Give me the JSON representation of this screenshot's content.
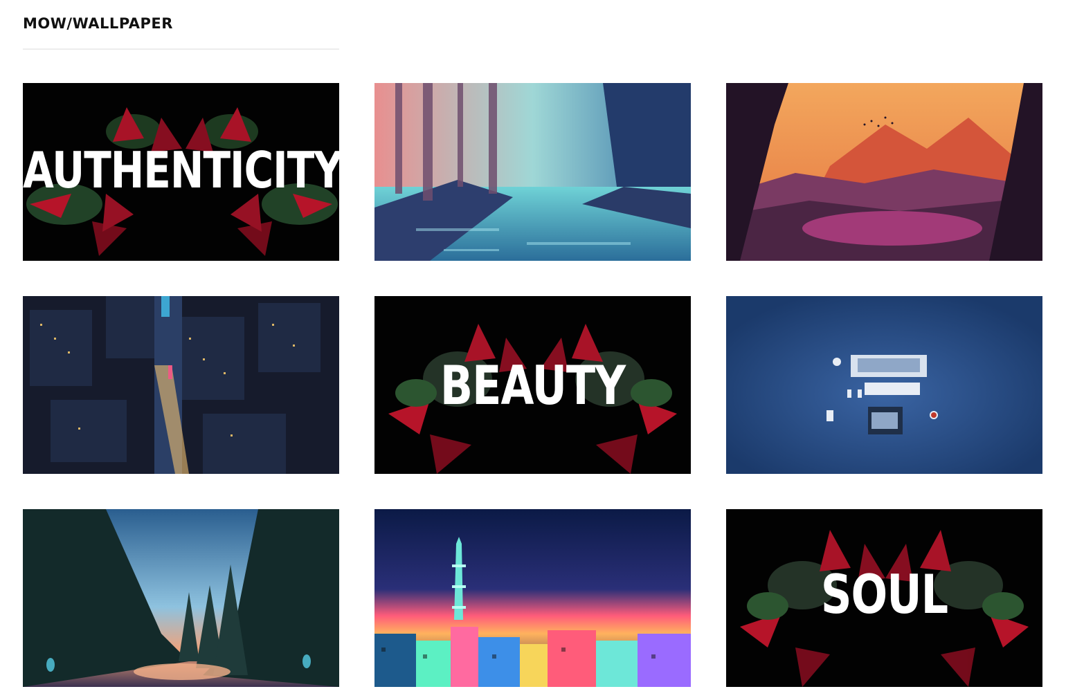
{
  "site": {
    "title": "MOW/WALLPAPER"
  },
  "wallpapers": [
    {
      "word": "AUTHENTICITY",
      "icon": "floral-word-image"
    },
    {
      "word": "",
      "icon": "forest-river-image"
    },
    {
      "word": "",
      "icon": "sunset-mountain-image"
    },
    {
      "word": "",
      "icon": "night-city-image"
    },
    {
      "word": "BEAUTY",
      "icon": "floral-word-image"
    },
    {
      "word": "",
      "icon": "desk-workspace-image"
    },
    {
      "word": "",
      "icon": "forest-dusk-image"
    },
    {
      "word": "",
      "icon": "neon-skyline-image"
    },
    {
      "word": "SOUL",
      "icon": "floral-word-image"
    }
  ],
  "colors": {
    "accent_red": "#c0162c",
    "leaf_green": "#2f5a33",
    "sky_sunset": "#f2a35c",
    "night_blue": "#1b3a6b"
  }
}
